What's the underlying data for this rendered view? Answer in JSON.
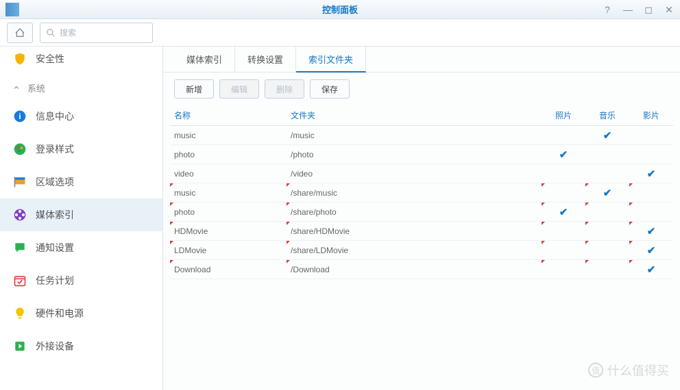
{
  "window": {
    "title": "控制面板",
    "help_label": "?",
    "min_label": "—",
    "max_label": "◻",
    "close_label": "✕"
  },
  "header": {
    "search_placeholder": "搜索"
  },
  "sidebar": {
    "group_label": "系统",
    "items_top": [
      {
        "label": "",
        "icon": "",
        "hidden": true
      },
      {
        "label": "安全性",
        "icon": "shield"
      }
    ],
    "items": [
      {
        "label": "信息中心",
        "icon": "info"
      },
      {
        "label": "登录样式",
        "icon": "palette"
      },
      {
        "label": "区域选项",
        "icon": "flag"
      },
      {
        "label": "媒体索引",
        "icon": "film",
        "active": true
      },
      {
        "label": "通知设置",
        "icon": "chat"
      },
      {
        "label": "任务计划",
        "icon": "calendar"
      },
      {
        "label": "硬件和电源",
        "icon": "bulb"
      },
      {
        "label": "外接设备",
        "icon": "external"
      }
    ]
  },
  "tabs": [
    {
      "label": "媒体索引"
    },
    {
      "label": "转换设置"
    },
    {
      "label": "索引文件夹",
      "active": true
    }
  ],
  "toolbar": {
    "create": "新增",
    "edit": "编辑",
    "delete": "删除",
    "save": "保存"
  },
  "table": {
    "headers": {
      "name": "名称",
      "folder": "文件夹",
      "photo": "照片",
      "music": "音乐",
      "video": "影片"
    },
    "rows": [
      {
        "name": "music",
        "folder": "/music",
        "photo": false,
        "music": true,
        "video": false,
        "marked": false
      },
      {
        "name": "photo",
        "folder": "/photo",
        "photo": true,
        "music": false,
        "video": false,
        "marked": false
      },
      {
        "name": "video",
        "folder": "/video",
        "photo": false,
        "music": false,
        "video": true,
        "marked": false
      },
      {
        "name": "music",
        "folder": "/share/music",
        "photo": false,
        "music": true,
        "video": false,
        "marked": true
      },
      {
        "name": "photo",
        "folder": "/share/photo",
        "photo": true,
        "music": false,
        "video": false,
        "marked": true
      },
      {
        "name": "HDMovie",
        "folder": "/share/HDMovie",
        "photo": false,
        "music": false,
        "video": true,
        "marked": true
      },
      {
        "name": "LDMovie",
        "folder": "/share/LDMovie",
        "photo": false,
        "music": false,
        "video": true,
        "marked": true
      },
      {
        "name": "Download",
        "folder": "/Download",
        "photo": false,
        "music": false,
        "video": true,
        "marked": true
      }
    ]
  },
  "watermark": {
    "symbol": "值",
    "text": "什么值得买"
  }
}
